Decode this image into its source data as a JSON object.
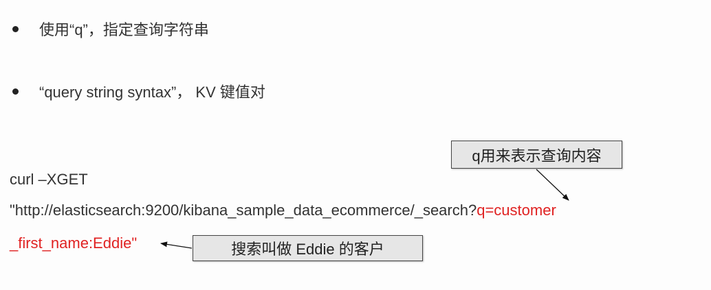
{
  "bullets": [
    {
      "text": "使用“q”，指定查询字符串"
    },
    {
      "text": "“query string syntax”， KV 键值对"
    }
  ],
  "code": {
    "line1": "curl –XGET",
    "line2_plain": "\"http://elasticsearch:9200/kibana_sample_data_ecommerce/_search?",
    "line2_red": "q=customer",
    "line3_red": "_first_name:Eddie\""
  },
  "callouts": {
    "q_meaning": "q用来表示查询内容",
    "search_meaning": "搜索叫做 Eddie 的客户"
  },
  "colors": {
    "highlight": "#e02222",
    "callout_bg": "#e6e6e6",
    "text": "#333333"
  }
}
